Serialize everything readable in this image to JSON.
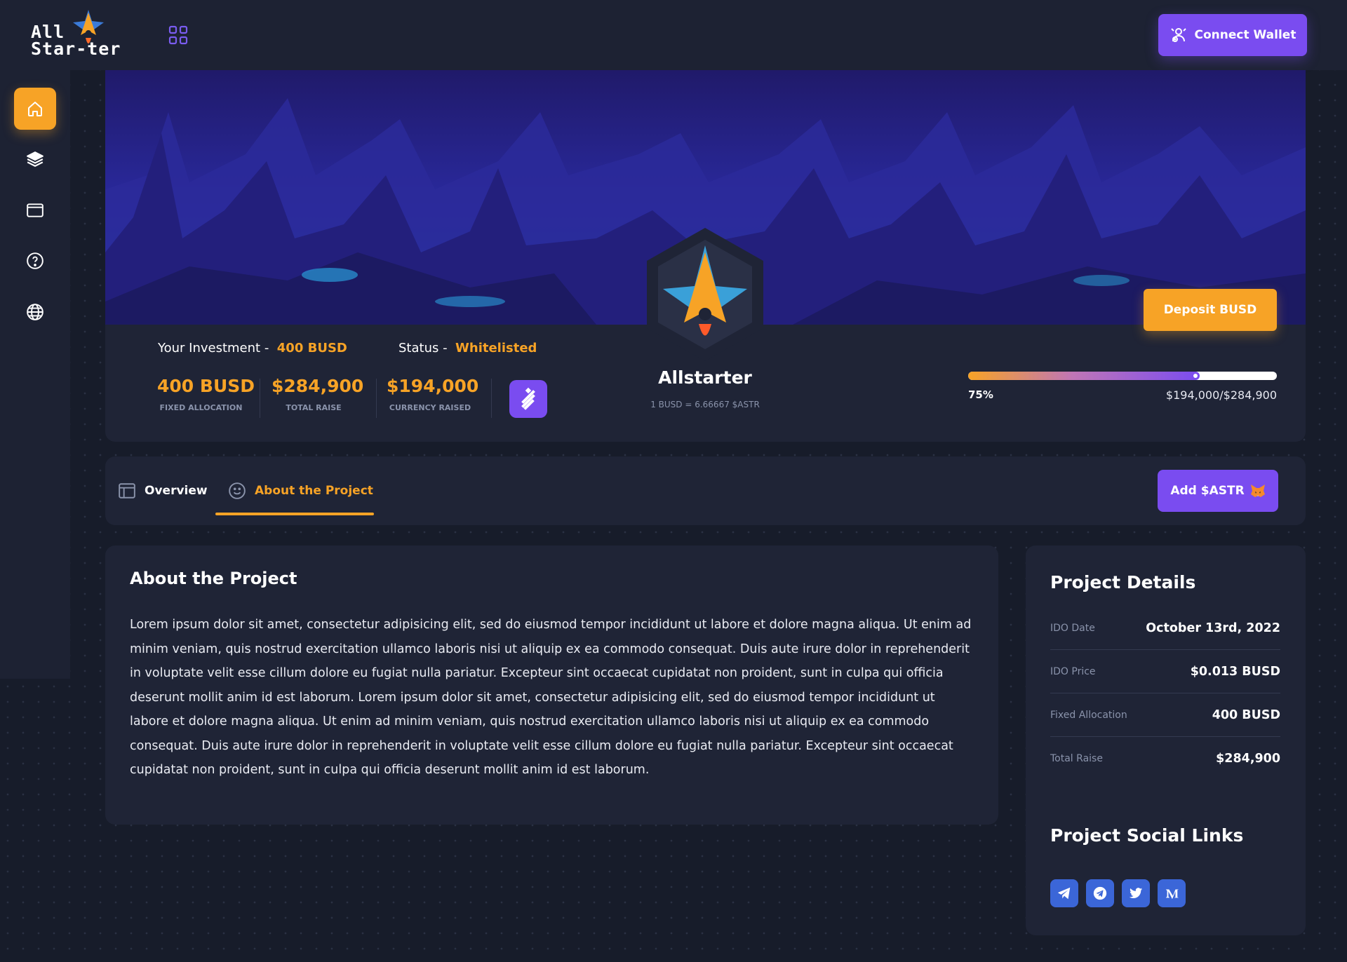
{
  "app": {
    "logo_text_line1": "All",
    "logo_text_line2": "Star-ter",
    "connect_wallet_label": "Connect Wallet"
  },
  "sidebar": {
    "items": [
      {
        "icon": "home-icon",
        "active": true
      },
      {
        "icon": "layers-icon",
        "active": false
      },
      {
        "icon": "window-icon",
        "active": false
      },
      {
        "icon": "help-icon",
        "active": false
      },
      {
        "icon": "globe-icon",
        "active": false
      }
    ]
  },
  "project": {
    "name": "Allstarter",
    "rate": "1 BUSD = 6.66667 $ASTR",
    "deposit_label": "Deposit BUSD",
    "investment_label": "Your Investment -",
    "investment_value": "400 BUSD",
    "status_label": "Status -",
    "status_value": "Whitelisted",
    "stats": [
      {
        "value": "400 BUSD",
        "label": "FIXED ALLOCATION"
      },
      {
        "value": "$284,900",
        "label": "TOTAL RAISE"
      },
      {
        "value": "$194,000",
        "label": "CURRENCY RAISED"
      }
    ],
    "progress": {
      "fraction": 0.75,
      "percent_label": "75%",
      "raised_label": "$194,000/$284,900"
    }
  },
  "tabs": {
    "items": [
      {
        "label": "Overview",
        "active": false
      },
      {
        "label": "About the Project",
        "active": true
      }
    ],
    "add_token_label": "Add $ASTR"
  },
  "about": {
    "title": "About the Project",
    "body": "Lorem ipsum dolor sit amet, consectetur adipisicing elit, sed do eiusmod tempor incididunt ut labore et dolore magna aliqua. Ut enim ad minim veniam, quis nostrud exercitation ullamco laboris nisi ut aliquip ex ea commodo consequat. Duis aute irure dolor in reprehenderit in voluptate velit esse cillum dolore eu fugiat nulla pariatur. Excepteur sint occaecat cupidatat non proident, sunt in culpa qui officia deserunt mollit anim id est laborum. Lorem ipsum dolor sit amet, consectetur adipisicing elit, sed do eiusmod tempor incididunt ut labore et dolore magna aliqua. Ut enim ad minim veniam, quis nostrud exercitation ullamco laboris nisi ut aliquip ex ea commodo consequat. Duis aute irure dolor in reprehenderit in voluptate velit esse cillum dolore eu fugiat nulla pariatur. Excepteur sint occaecat cupidatat non proident, sunt in culpa qui officia deserunt mollit anim id est laborum."
  },
  "details": {
    "title": "Project Details",
    "rows": [
      {
        "label": "IDO Date",
        "value": "October 13rd, 2022"
      },
      {
        "label": "IDO Price",
        "value": "$0.013 BUSD"
      },
      {
        "label": "Fixed Allocation",
        "value": "400 BUSD"
      },
      {
        "label": "Total Raise",
        "value": "$284,900"
      }
    ],
    "social_title": "Project Social Links",
    "social_links": [
      "telegram-plane-icon",
      "telegram-circle-icon",
      "twitter-icon",
      "medium-icon"
    ]
  },
  "colors": {
    "accent_orange": "#f7a326",
    "accent_purple": "#7a4cf0",
    "social_blue": "#3b66d8",
    "page_bg": "#171c2a",
    "card_bg": "#1f2436"
  }
}
